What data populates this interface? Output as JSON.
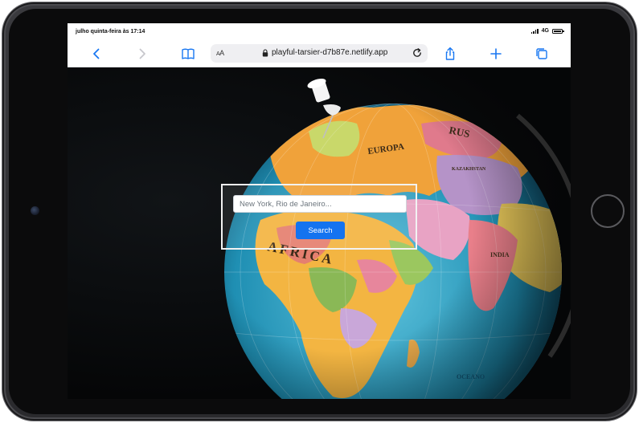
{
  "device": {
    "status_time": "julho quinta-feira às 17:14",
    "network": "4G",
    "battery_level": 1.0
  },
  "browser": {
    "text_size_label": "AA",
    "url": "playful-tarsier-d7b87e.netlify.app",
    "icons": {
      "back": "chevron-left-icon",
      "forward": "chevron-right-icon",
      "bookmarks": "book-icon",
      "lock": "lock-icon",
      "reload": "reload-icon",
      "share": "share-icon",
      "new_tab": "plus-icon",
      "tabs": "tabs-icon"
    },
    "accent_color": "#1877f2"
  },
  "page": {
    "search": {
      "placeholder": "New York, Rio de Janeiro...",
      "button_label": "Search",
      "button_color": "#1473f0"
    },
    "background": {
      "map_labels": [
        "EUROPA",
        "KAZAKHSTAN",
        "RUS",
        "AFRICA",
        "INDIA",
        "OCEANO"
      ]
    }
  }
}
